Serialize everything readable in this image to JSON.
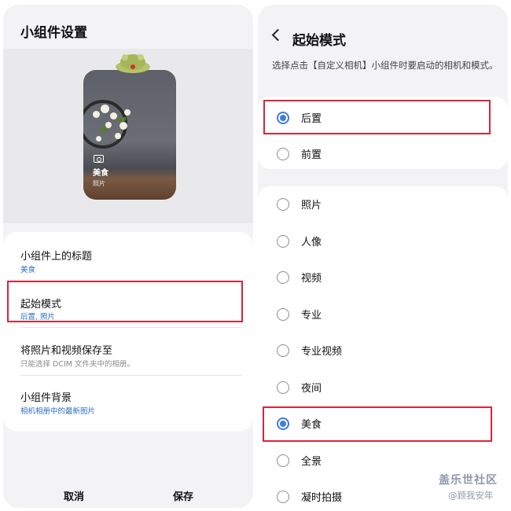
{
  "left_panel": {
    "title": "小组件设置",
    "preview": {
      "widget_title": "美食",
      "widget_subtitle": "照片"
    },
    "items": [
      {
        "title": "小组件上的标题",
        "value": "美食"
      },
      {
        "title": "起始模式",
        "value": "后置, 照片"
      },
      {
        "title": "将照片和视频保存至",
        "value": "只能选择 DCIM 文件夹中的相册。"
      },
      {
        "title": "小组件背景",
        "value": "相机相册中的最新图片"
      }
    ],
    "cancel_label": "取消",
    "save_label": "保存"
  },
  "right_panel": {
    "title": "起始模式",
    "description": "选择点击【自定义相机】小组件时要启动的相机和模式。",
    "camera_options": [
      {
        "label": "后置",
        "selected": true
      },
      {
        "label": "前置",
        "selected": false
      }
    ],
    "mode_options": [
      {
        "label": "照片",
        "selected": false
      },
      {
        "label": "人像",
        "selected": false
      },
      {
        "label": "视频",
        "selected": false
      },
      {
        "label": "专业",
        "selected": false
      },
      {
        "label": "专业视频",
        "selected": false
      },
      {
        "label": "夜间",
        "selected": false
      },
      {
        "label": "美食",
        "selected": true
      },
      {
        "label": "全景",
        "selected": false
      },
      {
        "label": "凝时拍摄",
        "selected": false
      }
    ]
  },
  "watermark": {
    "line1": "盖乐世社区",
    "line2": "@顾我安年"
  },
  "colors": {
    "accent": "#3f7ae0",
    "highlight_box": "#d7263a",
    "value_text": "#2f6fc4"
  }
}
